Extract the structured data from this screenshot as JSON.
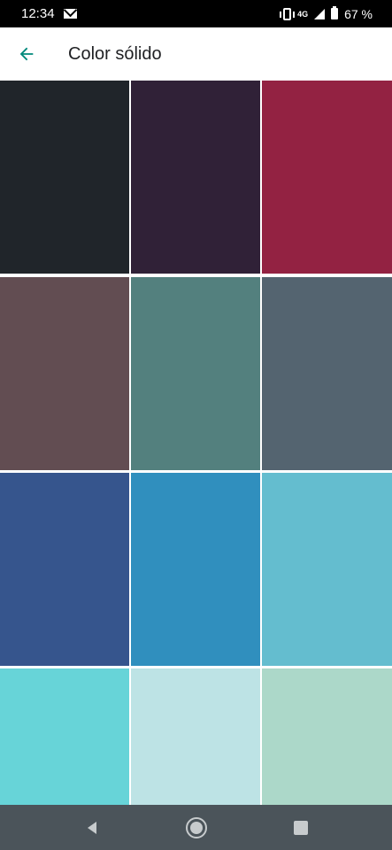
{
  "status_bar": {
    "time": "12:34",
    "network": "4G",
    "battery": "67 %"
  },
  "app_bar": {
    "title": "Color sólido"
  },
  "accent_color": "#00897b",
  "colors": [
    "#20252a",
    "#302137",
    "#932242",
    "#624d52",
    "#53807e",
    "#546470",
    "#36558d",
    "#308fbe",
    "#64bdcf",
    "#67d4d8",
    "#bde3e5",
    "#acd8c9"
  ],
  "icons": {
    "back": "arrow-back-icon",
    "mail": "mail-icon",
    "vibrate": "vibrate-icon",
    "signal": "signal-icon",
    "battery": "battery-icon",
    "nav_back": "triangle-back-icon",
    "nav_home": "circle-home-icon",
    "nav_recents": "square-recents-icon"
  }
}
